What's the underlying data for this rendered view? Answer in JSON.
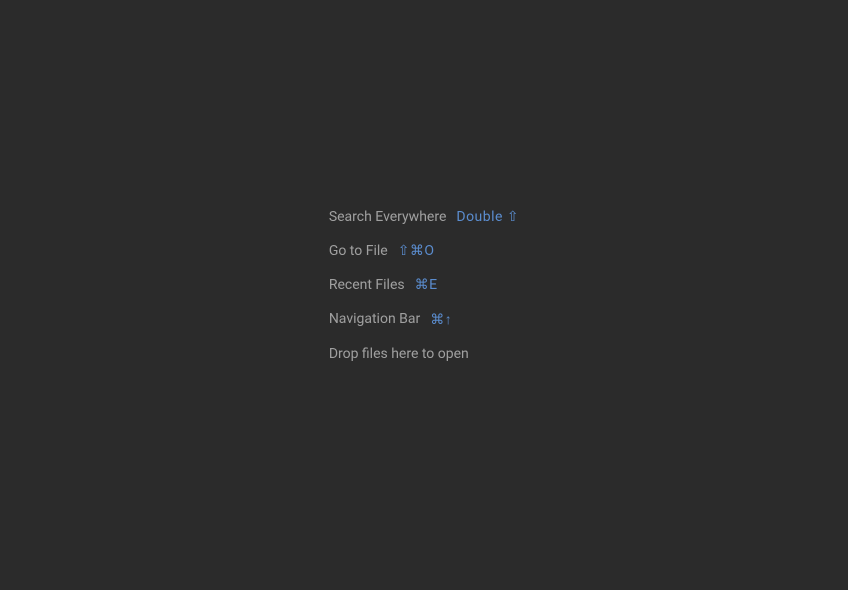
{
  "hints": {
    "search_everywhere": {
      "label": "Search Everywhere",
      "shortcut": "Double ⇧"
    },
    "go_to_file": {
      "label": "Go to File",
      "shortcut": "⇧⌘O"
    },
    "recent_files": {
      "label": "Recent Files",
      "shortcut": "⌘E"
    },
    "navigation_bar": {
      "label": "Navigation Bar",
      "shortcut": "⌘↑"
    },
    "drop_files": {
      "label": "Drop files here to open"
    }
  }
}
